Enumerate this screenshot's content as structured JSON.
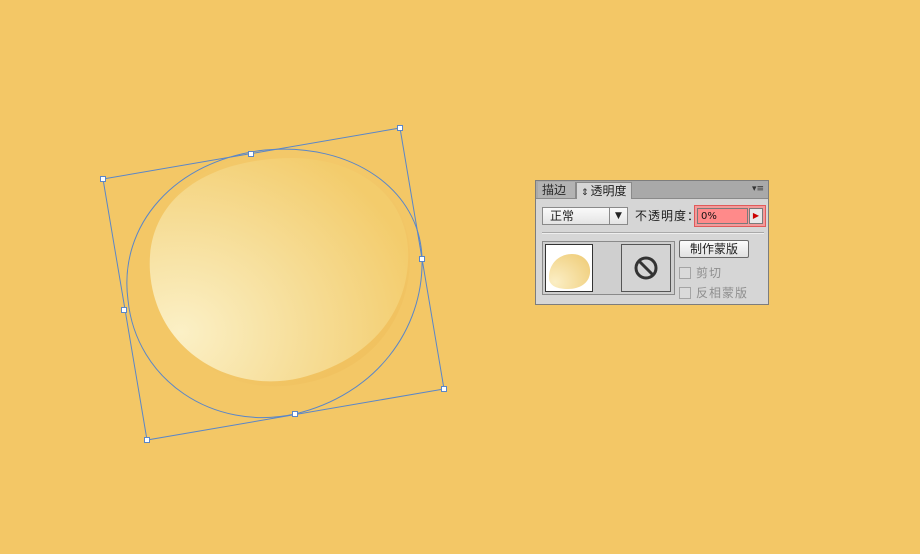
{
  "panel": {
    "tabs": [
      {
        "label": "描边",
        "active": false
      },
      {
        "label": "透明度",
        "active": true,
        "arrows": "⇕"
      }
    ],
    "menu_icon": "▾≡",
    "blend_mode": {
      "selected": "正常"
    },
    "opacity": {
      "label": "不透明度：",
      "value": "0%"
    },
    "make_mask_label": "制作蒙版",
    "clip": {
      "label": "剪切",
      "checked": false,
      "enabled": false
    },
    "invert_mask": {
      "label": "反相蒙版",
      "checked": false,
      "enabled": false
    }
  },
  "canvas": {
    "background": "#f3c766",
    "selection_color": "#5a86c8",
    "shape_fill_light": "#f9e9b6",
    "shape_fill_base": "#f4cf76"
  },
  "icons": [
    "dropdown-arrow-icon",
    "panel-menu-icon",
    "no-mask-icon",
    "stepper-arrow-icon"
  ]
}
